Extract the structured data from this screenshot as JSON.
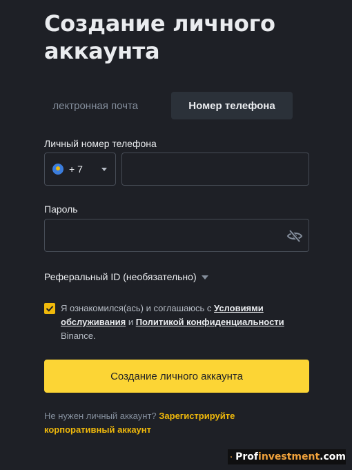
{
  "page": {
    "title": "Создание личного аккаунта"
  },
  "tabs": {
    "email": "лектронная почта",
    "phone": "Номер телефона"
  },
  "phone": {
    "label": "Личный номер телефона",
    "country_code": "+ 7",
    "value": ""
  },
  "password": {
    "label": "Пароль",
    "value": ""
  },
  "referral": {
    "label": "Реферальный ID (необязательно)"
  },
  "terms": {
    "checked": true,
    "prefix": "Я ознакомился(ась) и соглашаюсь с ",
    "link1": "Условиями обслуживания",
    "conj": " и ",
    "link2": "Политикой конфиденциальности",
    "suffix": " Binance."
  },
  "submit_label": "Создание личного аккаунта",
  "footer": {
    "text": "Не нужен личный аккаунт? ",
    "link": "Зарегистрируйте корпоративный аккаунт"
  },
  "watermark": {
    "part1": "Prof",
    "part2": "investment",
    "part3": ".com"
  },
  "colors": {
    "background": "#1e2026",
    "accent": "#fcd535",
    "link": "#f0b90b"
  }
}
